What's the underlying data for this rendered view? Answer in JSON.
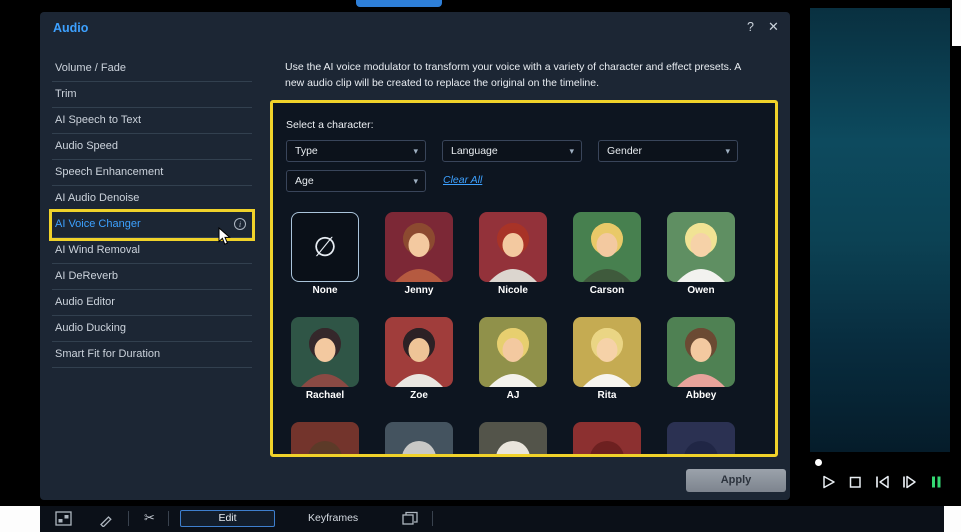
{
  "dialog": {
    "title": "Audio",
    "help_icon": "?",
    "close_icon": "✕"
  },
  "sidebar": {
    "items": [
      {
        "label": "Volume / Fade"
      },
      {
        "label": "Trim"
      },
      {
        "label": "AI Speech to Text"
      },
      {
        "label": "Audio Speed"
      },
      {
        "label": "Speech Enhancement"
      },
      {
        "label": "AI Audio Denoise"
      },
      {
        "label": "AI Voice Changer",
        "selected": true,
        "has_info": true
      },
      {
        "label": "AI Wind Removal"
      },
      {
        "label": "AI DeReverb"
      },
      {
        "label": "Audio Editor"
      },
      {
        "label": "Audio Ducking"
      },
      {
        "label": "Smart Fit for Duration"
      }
    ]
  },
  "main": {
    "description": "Use the AI voice modulator to transform your voice with a variety of character and effect presets. A new audio clip will be created to replace the original on the timeline.",
    "select_character_label": "Select a character:",
    "filters": [
      {
        "label": "Type",
        "row": 0,
        "col": 0
      },
      {
        "label": "Language",
        "row": 0,
        "col": 1
      },
      {
        "label": "Gender",
        "row": 0,
        "col": 2
      },
      {
        "label": "Age",
        "row": 1,
        "col": 0
      }
    ],
    "clear_all_label": "Clear All",
    "highlight_color": "#f0d22a",
    "characters": [
      {
        "name": "None",
        "kind": "none",
        "selected": true
      },
      {
        "name": "Jenny",
        "bg": "#7c2836",
        "hair": "#8c4a30",
        "skin": "#f3c9a0",
        "shirt": "#b55a40"
      },
      {
        "name": "Nicole",
        "bg": "#93323a",
        "hair": "#a83327",
        "skin": "#f3c9a0",
        "shirt": "#dcd6cf"
      },
      {
        "name": "Carson",
        "bg": "#47804f",
        "hair": "#e9c968",
        "skin": "#f3c9a0",
        "shirt": "#3f5a3c"
      },
      {
        "name": "Owen",
        "bg": "#5f8f62",
        "hair": "#f1e394",
        "skin": "#f6d2a8",
        "shirt": "#f2f2ef"
      },
      {
        "name": "Rachael",
        "bg": "#2f5546",
        "hair": "#35282b",
        "skin": "#f3c9a0",
        "shirt": "#8a4a44"
      },
      {
        "name": "Zoe",
        "bg": "#a03d3b",
        "hair": "#2c2125",
        "skin": "#eec497",
        "shirt": "#e9e6e1"
      },
      {
        "name": "AJ",
        "bg": "#90914a",
        "hair": "#e7cf6f",
        "skin": "#f3c9a0",
        "shirt": "#f4f2ec"
      },
      {
        "name": "Rita",
        "bg": "#c5ab52",
        "hair": "#ead584",
        "skin": "#f6d2a8",
        "shirt": "#f7f5ef"
      },
      {
        "name": "Abbey",
        "bg": "#4f8153",
        "hair": "#6b4a33",
        "skin": "#f3c9a0",
        "shirt": "#e8a39b"
      }
    ],
    "partial_row": [
      {
        "bg": "#73342c",
        "hair": "#5c3a28"
      },
      {
        "bg": "#44535f",
        "hair": "#c8c8c6"
      },
      {
        "bg": "#53544a",
        "hair": "#e9e5dc"
      },
      {
        "bg": "#8c3030",
        "hair": "#6d2020"
      },
      {
        "bg": "#2b3152",
        "hair": "#202645"
      }
    ],
    "apply_label": "Apply"
  },
  "preview": {
    "transport": [
      {
        "name": "play"
      },
      {
        "name": "stop"
      },
      {
        "name": "step-back"
      },
      {
        "name": "step-forward"
      },
      {
        "name": "pause",
        "color": "#35d973"
      }
    ]
  },
  "footer": {
    "edit_label": "Edit",
    "keyframes_label": "Keyframes"
  },
  "icons": {
    "caret": "▾",
    "none_symbol": "∅",
    "scissors": "✂",
    "info": "i"
  }
}
